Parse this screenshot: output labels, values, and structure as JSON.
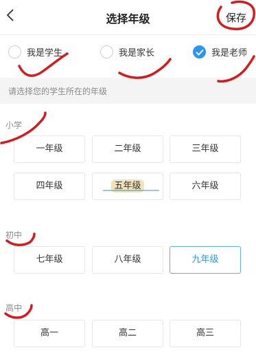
{
  "header": {
    "title": "选择年级",
    "save_label": "保存"
  },
  "roles": [
    {
      "label": "我是学生",
      "selected": false
    },
    {
      "label": "我是家长",
      "selected": false
    },
    {
      "label": "我是老师",
      "selected": true
    }
  ],
  "hint": "请选择您的学生所在的年级",
  "sections": {
    "primary": {
      "title": "小学",
      "grades": [
        "一年级",
        "二年级",
        "三年级",
        "四年级",
        "五年级",
        "六年级"
      ]
    },
    "middle": {
      "title": "初中",
      "grades": [
        "七年级",
        "八年级",
        "九年级"
      ],
      "selected": "九年级"
    },
    "high": {
      "title": "高中",
      "grades": [
        "高一",
        "高二",
        "高三"
      ]
    }
  },
  "colors": {
    "accent": "#2b95f1",
    "annotation": "#d7191c",
    "hint_bg": "#f4f4f4"
  }
}
